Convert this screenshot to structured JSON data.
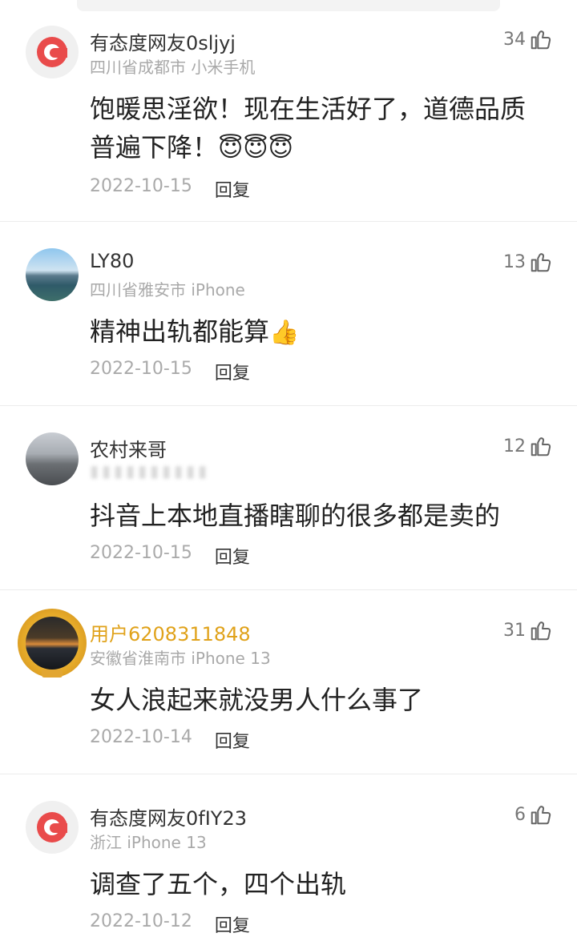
{
  "comments": [
    {
      "user": "有态度网友0sljyj",
      "location": "四川省成都市 小米手机",
      "likes": "34",
      "text": "饱暖思淫欲！现在生活好了，道德品质普遍下降！",
      "emoji": "😇😇😇",
      "date": "2022-10-15",
      "reply": "回复"
    },
    {
      "user": "LY80",
      "location": "四川省雅安市 iPhone",
      "likes": "13",
      "text": "精神出轨都能算",
      "emoji": "👍",
      "date": "2022-10-15",
      "reply": "回复"
    },
    {
      "user": "农村来哥",
      "location": "",
      "likes": "12",
      "text": "抖音上本地直播瞎聊的很多都是卖的",
      "emoji": "",
      "date": "2022-10-15",
      "reply": "回复"
    },
    {
      "user": "用户6208311848",
      "location": "安徽省淮南市 iPhone 13",
      "likes": "31",
      "text": "女人浪起来就没男人什么事了",
      "emoji": "",
      "date": "2022-10-14",
      "reply": "回复"
    },
    {
      "user": "有态度网友0fIY23",
      "location": "浙江 iPhone 13",
      "likes": "6",
      "text": "调查了五个，四个出轨",
      "emoji": "",
      "date": "2022-10-12",
      "reply": "回复"
    }
  ],
  "icons": {
    "like": "thumbs-up-icon",
    "logo_avatar": "netease-logo-icon"
  },
  "colors": {
    "vip_name": "#e0a21a",
    "logo_red": "#e94b4b"
  }
}
